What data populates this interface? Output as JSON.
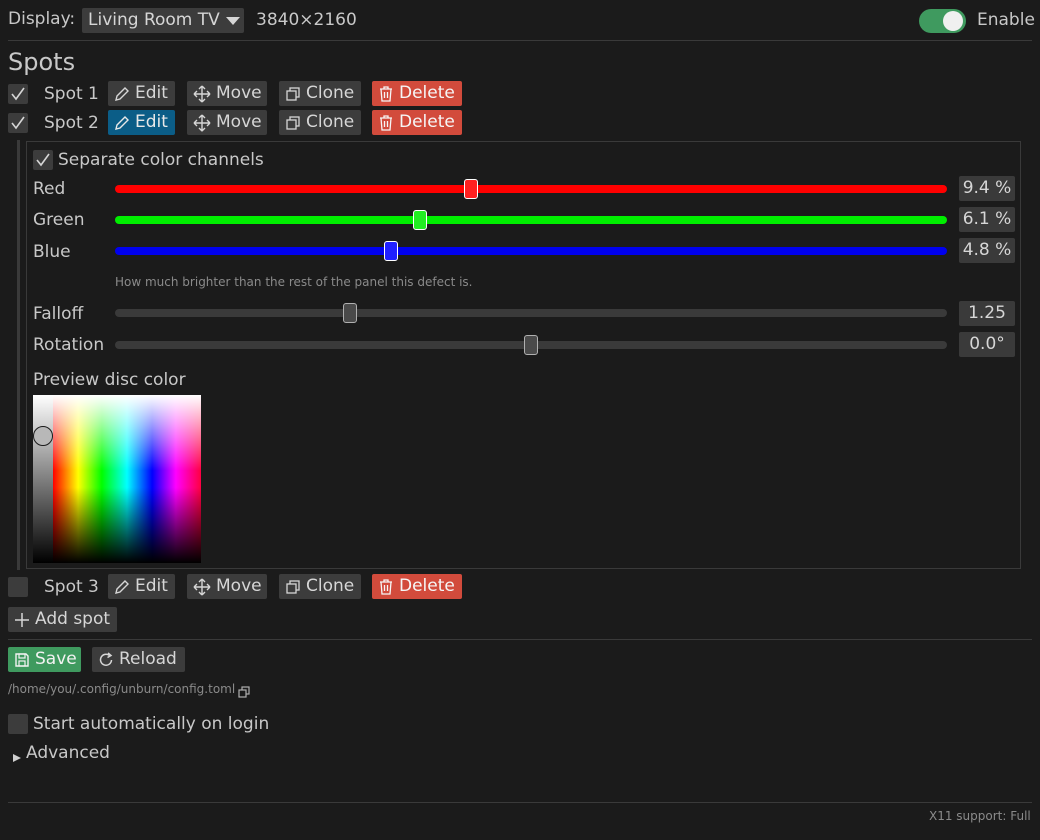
{
  "header": {
    "display_label": "Display:",
    "display_value": "Living Room TV",
    "resolution": "3840×2160",
    "enable_label": "Enable",
    "enabled": true
  },
  "spots_section": {
    "title": "Spots",
    "spots": [
      {
        "label": "Spot 1",
        "checked": true,
        "editing": false
      },
      {
        "label": "Spot 2",
        "checked": true,
        "editing": true
      },
      {
        "label": "Spot 3",
        "checked": false,
        "editing": false
      }
    ],
    "buttons": {
      "edit": "Edit",
      "move": "Move",
      "clone": "Clone",
      "delete": "Delete"
    },
    "add_spot": "Add spot"
  },
  "editor": {
    "separate_channels_label": "Separate color channels",
    "separate_channels_checked": true,
    "channels": [
      {
        "name": "Red",
        "value_text": "9.4 %",
        "fraction": 0.428,
        "color": "#ff0000"
      },
      {
        "name": "Green",
        "value_text": "6.1 %",
        "fraction": 0.366,
        "color": "#00ee00"
      },
      {
        "name": "Blue",
        "value_text": "4.8 %",
        "fraction": 0.332,
        "color": "#0000ee"
      }
    ],
    "hint": "How much brighter than the rest of the panel this defect is.",
    "falloff": {
      "label": "Falloff",
      "value_text": "1.25",
      "fraction": 0.282
    },
    "rotation": {
      "label": "Rotation",
      "value_text": "0.0°",
      "fraction": 0.5
    },
    "preview_label": "Preview disc color"
  },
  "footer": {
    "save": "Save",
    "reload": "Reload",
    "config_path": "/home/you/.config/unburn/config.toml",
    "autostart_label": "Start automatically on login",
    "autostart_checked": false,
    "advanced_label": "Advanced",
    "status": "X11 support: Full"
  },
  "colors": {
    "accent_blue": "#0b5d87",
    "danger": "#d24b3c",
    "save": "#3f9a5f",
    "toggle_on": "#3f9a5f"
  }
}
